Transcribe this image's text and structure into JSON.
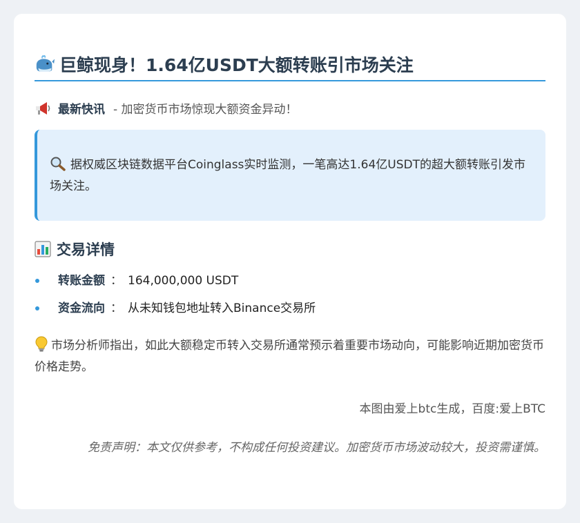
{
  "article": {
    "title": "巨鲸现身！1.64亿USDT大额转账引市场关注",
    "title_icon": "whale-icon",
    "news": {
      "icon": "megaphone-icon",
      "label": "最新快讯",
      "text": "- 加密货币市场惊现大额资金异动！"
    },
    "highlight": {
      "icon": "magnifier-icon",
      "text": "据权威区块链数据平台Coinglass实时监测，一笔高达1.64亿USDT的超大额转账引发市场关注。"
    },
    "details": {
      "icon": "bar-chart-icon",
      "title": "交易详情",
      "items": [
        {
          "key": "转账金额",
          "sep": "：",
          "value": "164,000,000 USDT"
        },
        {
          "key": "资金流向",
          "sep": "：",
          "value": "从未知钱包地址转入Binance交易所"
        }
      ]
    },
    "analysis": {
      "icon": "lightbulb-icon",
      "text": "市场分析师指出，如此大额稳定币转入交易所通常预示着重要市场动向，可能影响近期加密货币价格走势。"
    },
    "credit": "本图由爱上btc生成，百度:爱上BTC",
    "disclaimer": "免责声明：本文仅供参考，不构成任何投资建议。加密货币市场波动较大，投资需谨慎。"
  },
  "colors": {
    "accent": "#3498db",
    "heading": "#2c3e50",
    "highlight_bg": "#e3f0fc",
    "page_bg": "#eef1f5"
  }
}
